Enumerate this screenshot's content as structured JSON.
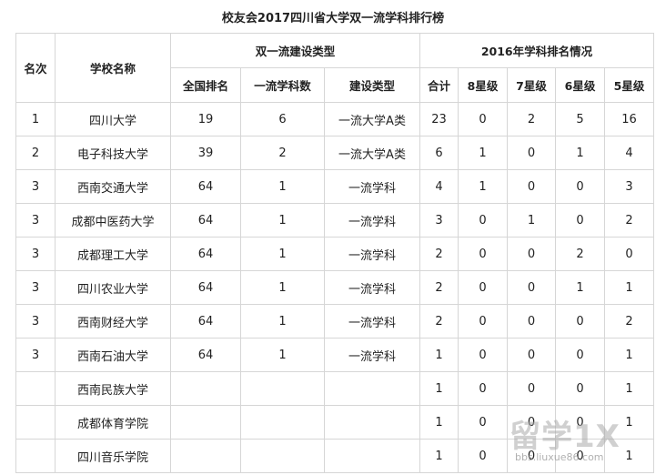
{
  "title": "校友会2017四川省大学双一流学科排行榜",
  "headers": {
    "rank": "名次",
    "school": "学校名称",
    "group_a": "双一流建设类型",
    "group_b": "2016年学科排名情况",
    "national_rank": "全国排名",
    "discipline_count": "一流学科数",
    "build_type": "建设类型",
    "total": "合计",
    "star8": "8星级",
    "star7": "7星级",
    "star6": "6星级",
    "star5": "5星级"
  },
  "rows": [
    {
      "rank": "1",
      "school": "四川大学",
      "national_rank": "19",
      "discipline_count": "6",
      "build_type": "一流大学A类",
      "total": "23",
      "star8": "0",
      "star7": "2",
      "star6": "5",
      "star5": "16"
    },
    {
      "rank": "2",
      "school": "电子科技大学",
      "national_rank": "39",
      "discipline_count": "2",
      "build_type": "一流大学A类",
      "total": "6",
      "star8": "1",
      "star7": "0",
      "star6": "1",
      "star5": "4"
    },
    {
      "rank": "3",
      "school": "西南交通大学",
      "national_rank": "64",
      "discipline_count": "1",
      "build_type": "一流学科",
      "total": "4",
      "star8": "1",
      "star7": "0",
      "star6": "0",
      "star5": "3"
    },
    {
      "rank": "3",
      "school": "成都中医药大学",
      "national_rank": "64",
      "discipline_count": "1",
      "build_type": "一流学科",
      "total": "3",
      "star8": "0",
      "star7": "1",
      "star6": "0",
      "star5": "2"
    },
    {
      "rank": "3",
      "school": "成都理工大学",
      "national_rank": "64",
      "discipline_count": "1",
      "build_type": "一流学科",
      "total": "2",
      "star8": "0",
      "star7": "0",
      "star6": "2",
      "star5": "0"
    },
    {
      "rank": "3",
      "school": "四川农业大学",
      "national_rank": "64",
      "discipline_count": "1",
      "build_type": "一流学科",
      "total": "2",
      "star8": "0",
      "star7": "0",
      "star6": "1",
      "star5": "1"
    },
    {
      "rank": "3",
      "school": "西南财经大学",
      "national_rank": "64",
      "discipline_count": "1",
      "build_type": "一流学科",
      "total": "2",
      "star8": "0",
      "star7": "0",
      "star6": "0",
      "star5": "2"
    },
    {
      "rank": "3",
      "school": "西南石油大学",
      "national_rank": "64",
      "discipline_count": "1",
      "build_type": "一流学科",
      "total": "1",
      "star8": "0",
      "star7": "0",
      "star6": "0",
      "star5": "1"
    },
    {
      "rank": "",
      "school": "西南民族大学",
      "national_rank": "",
      "discipline_count": "",
      "build_type": "",
      "total": "1",
      "star8": "0",
      "star7": "0",
      "star6": "0",
      "star5": "1"
    },
    {
      "rank": "",
      "school": "成都体育学院",
      "national_rank": "",
      "discipline_count": "",
      "build_type": "",
      "total": "1",
      "star8": "0",
      "star7": "0",
      "star6": "0",
      "star5": "1"
    },
    {
      "rank": "",
      "school": "四川音乐学院",
      "national_rank": "",
      "discipline_count": "",
      "build_type": "",
      "total": "1",
      "star8": "0",
      "star7": "0",
      "star6": "0",
      "star5": "1"
    }
  ],
  "watermark": {
    "logo_text": "留学1X",
    "url": "bbs.liuxue86.com"
  }
}
